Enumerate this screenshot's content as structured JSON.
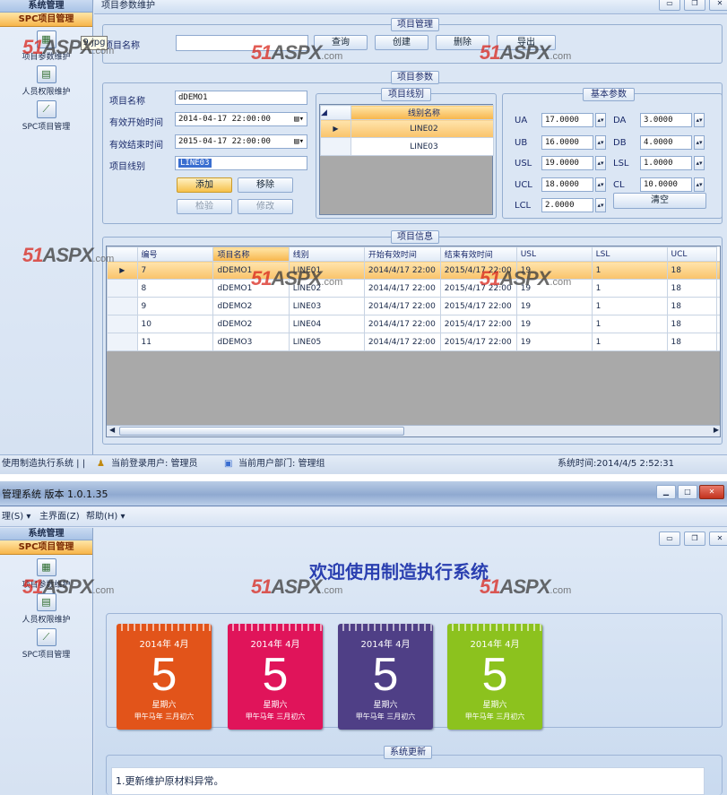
{
  "top": {
    "sidebar": {
      "header": "系统管理",
      "section": "SPC项目管理",
      "items": [
        {
          "label": "项目参数维护",
          "icon": "project-params-icon"
        },
        {
          "label": "人员权限维护",
          "icon": "user-permission-icon"
        },
        {
          "label": "SPC项目管理",
          "icon": "spc-chart-icon"
        }
      ]
    },
    "tab_title": "项目参数维护",
    "tooltip": "9.jpg",
    "mgmt": {
      "title": "项目管理",
      "label": "项目名称",
      "value": "",
      "buttons": [
        "查询",
        "创建",
        "删除",
        "导出"
      ]
    },
    "params": {
      "title": "项目参数",
      "name_label": "项目名称",
      "name_value": "dDEMO1",
      "start_label": "有效开始时间",
      "start_value": "2014-04-17 22:00:00",
      "end_label": "有效结束时间",
      "end_value": "2015-04-17 22:00:00",
      "line_label": "项目线别",
      "line_value": "LINE03",
      "add": "添加",
      "remove": "移除",
      "check": "检验",
      "modify": "修改"
    },
    "lines": {
      "title": "项目线别",
      "header": "线别名称",
      "rows": [
        "LINE02",
        "LINE03"
      ]
    },
    "basic": {
      "title": "基本参数",
      "fields": [
        {
          "label": "UA",
          "value": "17.0000"
        },
        {
          "label": "DA",
          "value": "3.0000"
        },
        {
          "label": "UB",
          "value": "16.0000"
        },
        {
          "label": "DB",
          "value": "4.0000"
        },
        {
          "label": "USL",
          "value": "19.0000"
        },
        {
          "label": "LSL",
          "value": "1.0000"
        },
        {
          "label": "UCL",
          "value": "18.0000"
        },
        {
          "label": "CL",
          "value": "10.0000"
        },
        {
          "label": "LCL",
          "value": "2.0000"
        }
      ],
      "clear": "清空"
    },
    "info": {
      "title": "项目信息",
      "columns": [
        "编号",
        "项目名称",
        "线别",
        "开始有效时间",
        "结束有效时间",
        "USL",
        "LSL",
        "UCL"
      ],
      "rows": [
        [
          "7",
          "dDEMO1",
          "LINE01",
          "2014/4/17 22:00",
          "2015/4/17 22:00",
          "19",
          "1",
          "18"
        ],
        [
          "8",
          "dDEMO1",
          "LINE02",
          "2014/4/17 22:00",
          "2015/4/17 22:00",
          "19",
          "1",
          "18"
        ],
        [
          "9",
          "dDEMO2",
          "LINE03",
          "2014/4/17 22:00",
          "2015/4/17 22:00",
          "19",
          "1",
          "18"
        ],
        [
          "10",
          "dDEMO2",
          "LINE04",
          "2014/4/17 22:00",
          "2015/4/17 22:00",
          "19",
          "1",
          "18"
        ],
        [
          "11",
          "dDEMO3",
          "LINE05",
          "2014/4/17 22:00",
          "2015/4/17 22:00",
          "19",
          "1",
          "18"
        ]
      ]
    },
    "status": {
      "app": "使用制造执行系统 | |",
      "user": "当前登录用户: 管理员",
      "dept": "当前用户部门: 管理组",
      "time": "系统时间:2014/4/5 2:52:31"
    }
  },
  "bottom": {
    "title": "管理系统 版本 1.0.1.35",
    "menu": [
      "理(S) ▾",
      "主界面(Z)",
      "帮助(H) ▾"
    ],
    "sidebar": {
      "header": "系统管理",
      "section": "SPC项目管理",
      "items": [
        {
          "label": "项目参数维护",
          "icon": "project-params-icon"
        },
        {
          "label": "人员权限维护",
          "icon": "user-permission-icon"
        },
        {
          "label": "SPC项目管理",
          "icon": "spc-chart-icon"
        }
      ]
    },
    "welcome": "欢迎使用制造执行系统",
    "calendars": [
      {
        "ym": "2014年 4月",
        "day": "5",
        "weekday": "星期六",
        "lunar": "甲午马年 三月初六",
        "color": "#e2541a"
      },
      {
        "ym": "2014年 4月",
        "day": "5",
        "weekday": "星期六",
        "lunar": "甲午马年 三月初六",
        "color": "#e0145a"
      },
      {
        "ym": "2014年 4月",
        "day": "5",
        "weekday": "星期六",
        "lunar": "甲午马年 三月初六",
        "color": "#4f3f86"
      },
      {
        "ym": "2014年 4月",
        "day": "5",
        "weekday": "星期六",
        "lunar": "甲午马年 三月初六",
        "color": "#8cc21e"
      }
    ],
    "update_title": "系统更新",
    "update_text": "1.更新维护原材料异常。"
  },
  "watermark": {
    "brand": "51",
    "mid": "ASPX",
    "tld": ".com"
  }
}
